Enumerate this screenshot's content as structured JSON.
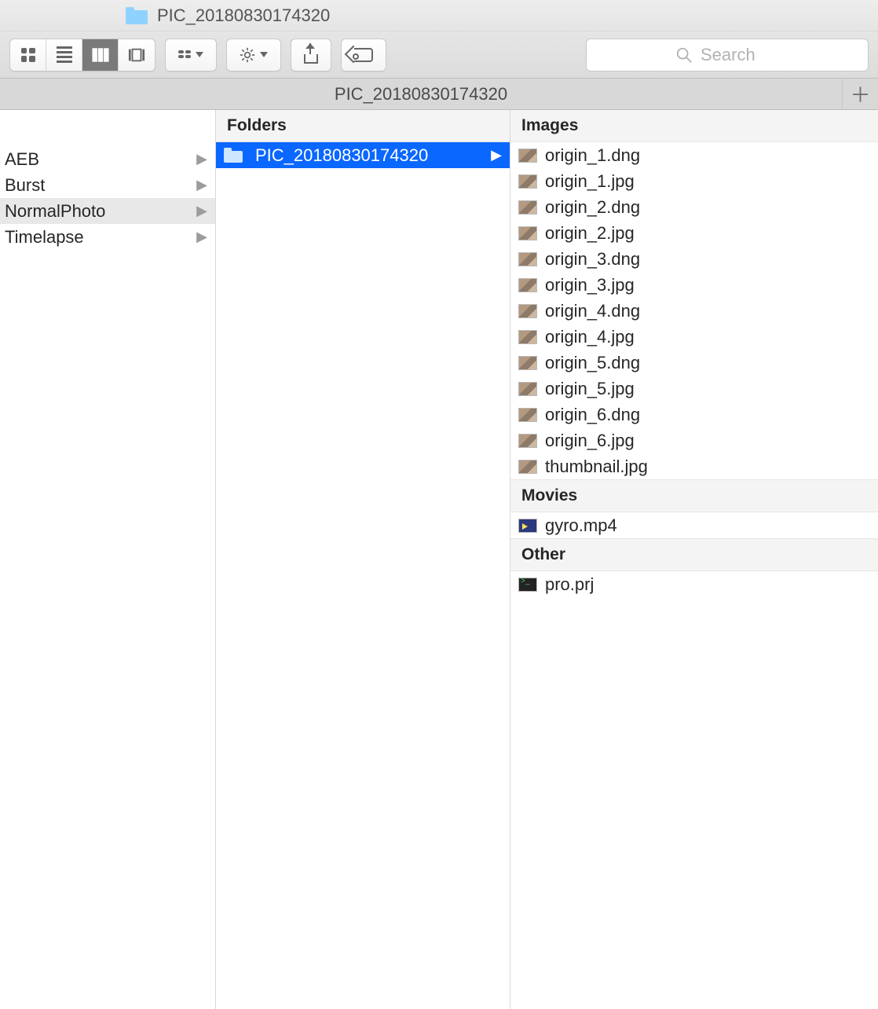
{
  "window": {
    "title": "PIC_20180830174320"
  },
  "toolbar": {
    "search_placeholder": "Search"
  },
  "tabbar": {
    "tab_label": "PIC_20180830174320"
  },
  "columns": {
    "col2_header": "Folders",
    "col3_headers": {
      "images": "Images",
      "movies": "Movies",
      "other": "Other"
    }
  },
  "col1_items": [
    {
      "label": "AEB",
      "selected": false
    },
    {
      "label": "Burst",
      "selected": false
    },
    {
      "label": "NormalPhoto",
      "selected": true
    },
    {
      "label": "Timelapse",
      "selected": false
    }
  ],
  "col2_items": [
    {
      "label": "PIC_20180830174320",
      "selected": true
    }
  ],
  "col3_images": [
    "origin_1.dng",
    "origin_1.jpg",
    "origin_2.dng",
    "origin_2.jpg",
    "origin_3.dng",
    "origin_3.jpg",
    "origin_4.dng",
    "origin_4.jpg",
    "origin_5.dng",
    "origin_5.jpg",
    "origin_6.dng",
    "origin_6.jpg",
    "thumbnail.jpg"
  ],
  "col3_movies": [
    "gyro.mp4"
  ],
  "col3_other": [
    "pro.prj"
  ]
}
